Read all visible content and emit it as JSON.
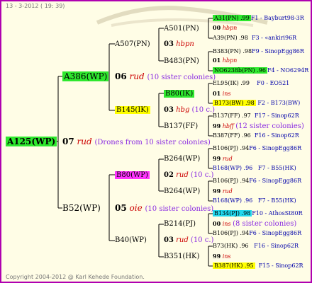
{
  "header": "13 - 3-2012 ( 19: 39)",
  "footer": "Copyright 2004-2012 @ Karl Kehede Foundation.",
  "colors": {
    "border": "#b000b0",
    "bg": "#fffde6",
    "green": "#2ee82e",
    "yellow": "#ffff00",
    "magenta": "#ff33ff",
    "cyan": "#22d8ee"
  },
  "root": {
    "label": "A125(WP)",
    "year": "07",
    "code": "rud",
    "note": "(Drones from 10 sister colonies)"
  },
  "g1": {
    "mother": {
      "label": "A386(WP)",
      "year": "06",
      "code": "rud",
      "note": "(10 sister colonies)"
    },
    "father": {
      "label": "B52(WP)",
      "year": "05",
      "code": "oie",
      "note": "(10 sister colonies)"
    }
  },
  "g2": [
    {
      "label": "A507(PN)",
      "year": "03",
      "code": "hbpn"
    },
    {
      "label": "B145(IK)",
      "year": "03",
      "code": "hbg",
      "note": "(10 c.)"
    },
    {
      "label": "B80(WP)",
      "year": "02",
      "code": "rud",
      "note": "(10 c.)"
    },
    {
      "label": "B40(WP)",
      "year": "03",
      "code": "rud",
      "note": "(10 c.)"
    }
  ],
  "g3": [
    {
      "label": "A501(PN)",
      "year": "00",
      "code": "hbpn"
    },
    {
      "label": "B483(PN)",
      "year": "01",
      "code": "hbpn"
    },
    {
      "label": "B80(IK)",
      "year": "01",
      "code": "ins"
    },
    {
      "label": "B137(FF)",
      "year": "99",
      "code": "hbff",
      "note": "(12 sister colonies)"
    },
    {
      "label": "B264(WP)",
      "year": "99",
      "code": "rud"
    },
    {
      "label": "B264(WP)",
      "year": "99",
      "code": "rud"
    },
    {
      "label": "B214(PJ)",
      "year": "00",
      "code": "ins",
      "note": "(8 sister colonies)"
    },
    {
      "label": "B351(HK)",
      "year": "99",
      "code": "ins"
    }
  ],
  "g4": [
    {
      "left": "A31(PN) .99",
      "right": "F1 - Bayburt98-3R"
    },
    {
      "left": "A39(PN) .98",
      "right": "F3 - «ankiri96R"
    },
    {
      "left": "B383(PN) .98",
      "right": "F9 - SinopEgg86R"
    },
    {
      "left": "NO6238b(PN) .96",
      "right": "F4 - NO6294R"
    },
    {
      "left": "EL95(IK) .99",
      "right": "F0 - EO521"
    },
    {
      "left": "B173(BW) .98",
      "right": "F2 - B173(BW)"
    },
    {
      "left": "B137(FF) .97",
      "right": "F17 - Sinop62R"
    },
    {
      "left": "B387(FF) .96",
      "right": "F16 - Sinop62R"
    },
    {
      "left": "B106(PJ) .94",
      "right": "F6 - SinopEgg86R"
    },
    {
      "left": "B168(WP) .96",
      "right": "F7 - B55(HK)"
    },
    {
      "left": "B106(PJ) .94",
      "right": "F6 - SinopEgg86R"
    },
    {
      "left": "B168(WP) .96",
      "right": "F7 - B55(HK)"
    },
    {
      "left": "B134(PJ) .98",
      "right": "F10 - AthosSt80R"
    },
    {
      "left": "B106(PJ) .94",
      "right": "F6 - SinopEgg86R"
    },
    {
      "left": "B73(HK) .96",
      "right": "F16 - Sinop62R"
    },
    {
      "left": "B387(HK) .95",
      "right": "F15 - Sinop62R"
    }
  ]
}
